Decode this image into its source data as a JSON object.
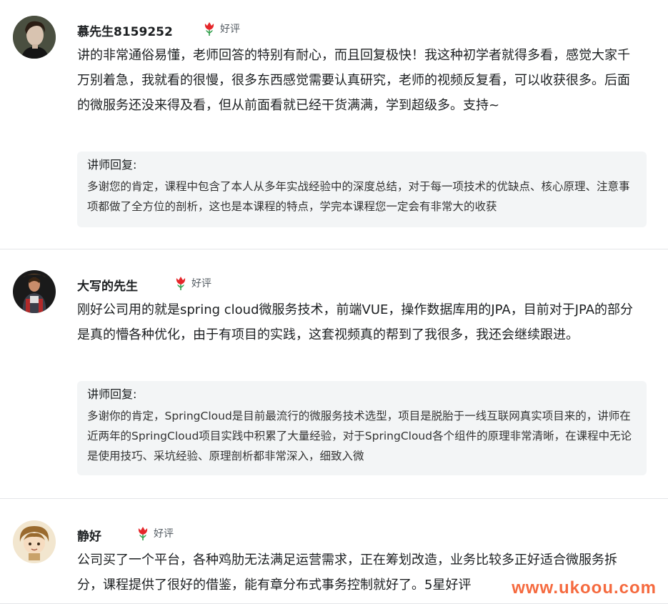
{
  "reviews": [
    {
      "avatar": "user-avatar-man-portrait",
      "name": "慕先生8159252",
      "rating_icon": "flower-icon",
      "rating_label": "好评",
      "content": "讲的非常通俗易懂，老师回答的特别有耐心，而且回复极快！我这种初学者就得多看，感觉大家千万别着急，我就看的很慢，很多东西感觉需要认真研究，老师的视频反复看，可以收获很多。后面的微服务还没来得及看，但从前面看就已经干货满满，学到超级多。支持~",
      "reply_label": "讲师回复:",
      "reply_text": "多谢您的肯定，课程中包含了本人从多年实战经验中的深度总结，对于每一项技术的优缺点、核心原理、注意事项都做了全方位的剖析，这也是本课程的特点，学完本课程您一定会有非常大的收获"
    },
    {
      "avatar": "user-avatar-character",
      "name": "大写的先生",
      "rating_icon": "flower-icon",
      "rating_label": "好评",
      "content": "刚好公司用的就是spring cloud微服务技术，前端VUE，操作数据库用的JPA，目前对于JPA的部分是真的懵各种优化，由于有项目的实践，这套视频真的帮到了我很多，我还会继续跟进。",
      "reply_label": "讲师回复:",
      "reply_text": "多谢你的肯定，SpringCloud是目前最流行的微服务技术选型，项目是脱胎于一线互联网真实项目来的，讲师在近两年的SpringCloud项目实践中积累了大量经验，对于SpringCloud各个组件的原理非常清晰，在课程中无论是使用技巧、采坑经验、原理剖析都非常深入，细致入微"
    },
    {
      "avatar": "user-avatar-cartoon",
      "name": "静好",
      "rating_icon": "flower-icon",
      "rating_label": "好评",
      "content": "公司买了一个平台，各种鸡肋无法满足运营需求，正在筹划改造，业务比较多正好适合微服务拆分，课程提供了很好的借鉴，能有章分布式事务控制就好了。5星好评"
    }
  ],
  "watermark": "www.ukoou.com",
  "colors": {
    "accent_flower": "#e5262a",
    "reply_bg": "#f3f5f6",
    "divider": "#e4e6e8",
    "watermark": "#f4511e"
  }
}
